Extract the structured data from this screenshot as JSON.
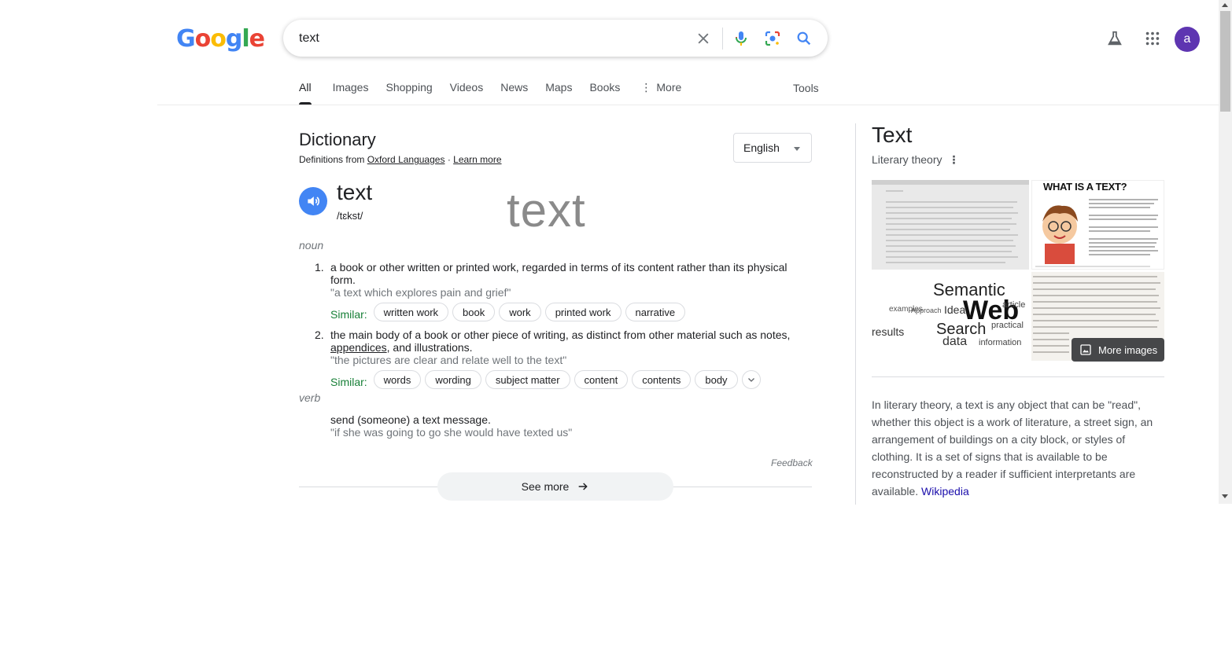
{
  "logo": {
    "letters": [
      "G",
      "o",
      "o",
      "g",
      "l",
      "e"
    ],
    "colors": [
      "#4285f4",
      "#ea4335",
      "#fbbc05",
      "#4285f4",
      "#34a853",
      "#ea4335"
    ]
  },
  "search": {
    "value": "text",
    "clear_icon": "close-icon",
    "voice_icon": "mic-icon",
    "lens_icon": "lens-icon",
    "search_icon": "search-icon"
  },
  "header_right": {
    "labs_icon": "flask-icon",
    "apps_icon": "apps-grid-icon",
    "avatar_letter": "a",
    "avatar_color": "#5e35b1"
  },
  "tabs": [
    {
      "label": "All",
      "active": true
    },
    {
      "label": "Images"
    },
    {
      "label": "Shopping"
    },
    {
      "label": "Videos"
    },
    {
      "label": "News"
    },
    {
      "label": "Maps"
    },
    {
      "label": "Books"
    },
    {
      "label": "More"
    }
  ],
  "tools_label": "Tools",
  "dictionary": {
    "title": "Dictionary",
    "source_prefix": "Definitions from",
    "source_link": "Oxford Languages",
    "separator": "·",
    "learn_more": "Learn more",
    "language": "English",
    "word": "text",
    "phonetic": "/tɛkst/",
    "word_image_text": "text",
    "noun_label": "noun",
    "noun_defs": [
      {
        "num": "1.",
        "text": "a book or other written or printed work, regarded in terms of its content rather than its physical form.",
        "example": "\"a text which explores pain and grief\"",
        "similar_label": "Similar:",
        "similar": [
          "written work",
          "book",
          "work",
          "printed work",
          "narrative"
        ]
      },
      {
        "num": "2.",
        "text_before": "the main body of a book or other piece of writing, as distinct from other material such as notes, ",
        "link": "appendices",
        "text_after": ", and illustrations.",
        "example": "\"the pictures are clear and relate well to the text\"",
        "similar_label": "Similar:",
        "similar": [
          "words",
          "wording",
          "subject matter",
          "content",
          "contents",
          "body"
        ]
      }
    ],
    "verb_label": "verb",
    "verb_def": {
      "text": "send (someone) a text message.",
      "example": "\"if she was going to go she would have texted us\""
    },
    "feedback": "Feedback",
    "see_more": "See more"
  },
  "knowledge_panel": {
    "title": "Text",
    "subtitle": "Literary theory",
    "image2_heading": "WHAT IS A TEXT?",
    "image3_words": [
      "Semantic",
      "Web",
      "Search",
      "data",
      "results",
      "Idea",
      "article",
      "practical",
      "information",
      "Approach",
      "examples"
    ],
    "more_images": "More images",
    "description": "In literary theory, a text is any object that can be \"read\", whether this object is a work of literature, a street sign, an arrangement of buildings on a city block, or styles of clothing. It is a set of signs that is available to be reconstructed by a reader if sufficient interpretants are available.",
    "wiki_link": "Wikipedia"
  }
}
